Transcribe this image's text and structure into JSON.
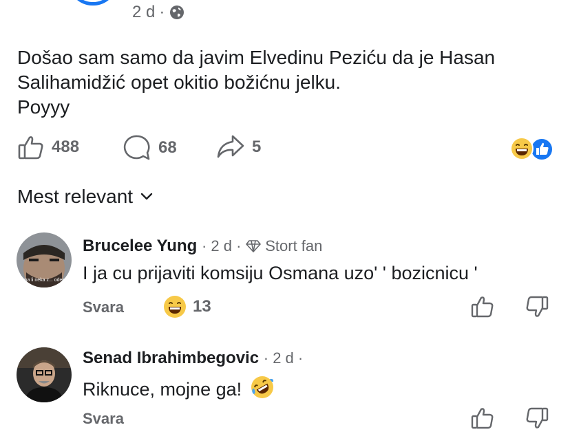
{
  "post": {
    "time": "2 d",
    "dot": "·",
    "text_lines": [
      "Došao sam samo da javim Elvedinu Peziću da je Hasan",
      "Salihamidžić opet okitio božićnu jelku.",
      "Poyyy"
    ],
    "likes": "488",
    "comments": "68",
    "shares": "5"
  },
  "sort": {
    "label": "Mest relevant"
  },
  "comments": [
    {
      "author": "Brucelee Yung",
      "meta_time": "· 2 d ·",
      "badge": "Stort fan",
      "avatar_caption": "Ima li neka z... odem",
      "text": "I ja cu prijaviti komsiju Osmana uzo' ' bozicnicu '",
      "reply_label": "Svara",
      "reaction_count": "13"
    },
    {
      "author": "Senad Ibrahimbegovic",
      "meta_time": "· 2 d ·",
      "text": "Riknuce, mojne ga!",
      "reply_label": "Svara"
    }
  ],
  "colors": {
    "accent": "#1877f2",
    "muted": "#65676b",
    "text": "#1c1e21"
  }
}
